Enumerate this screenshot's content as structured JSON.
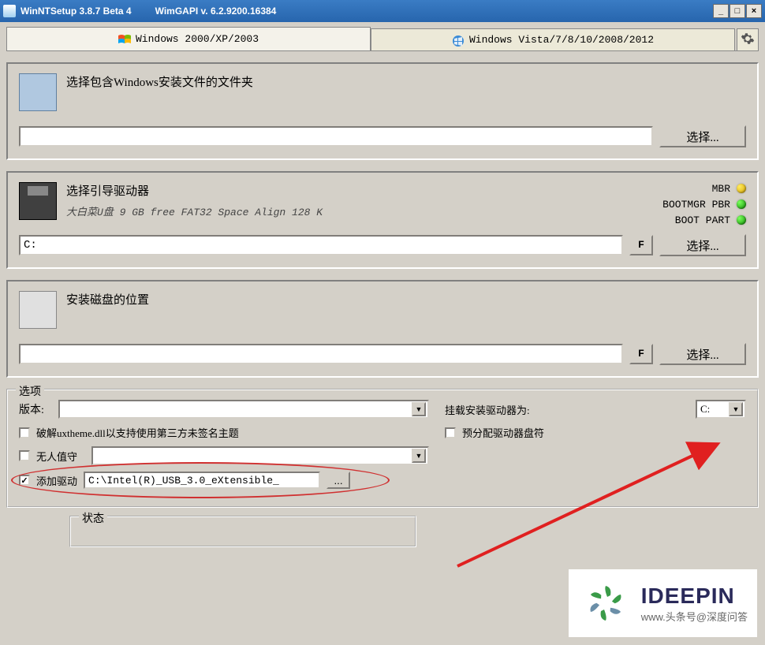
{
  "window": {
    "title": "WinNTSetup 3.8.7 Beta 4",
    "api": "WimGAPI v. 6.2.9200.16384"
  },
  "tabs": {
    "tab1": "Windows 2000/XP/2003",
    "tab2": "Windows Vista/7/8/10/2008/2012"
  },
  "panel1": {
    "title": "选择包含Windows安装文件的文件夹",
    "value": "",
    "select": "选择..."
  },
  "panel2": {
    "title": "选择引导驱动器",
    "sub": "大白菜U盘 9 GB free FAT32 Space Align 128 K",
    "value": "C:",
    "f": "F",
    "select": "选择...",
    "lights": {
      "mbr": "MBR",
      "pbr": "BOOTMGR PBR",
      "part": "BOOT PART"
    }
  },
  "panel3": {
    "title": "安装磁盘的位置",
    "value": "",
    "f": "F",
    "select": "选择..."
  },
  "options": {
    "legend": "选项",
    "version_label": "版本:",
    "version": "",
    "uxtheme": "破解uxtheme.dll以支持使用第三方未签名主题",
    "unattend": "无人值守",
    "adddriver": "添加驱动",
    "driver_path": "C:\\Intel(R)_USB_3.0_eXtensible_",
    "mount_label": "挂载安装驱动器为:",
    "mount_value": "C:",
    "prealloc": "预分配驱动器盘符"
  },
  "status": {
    "legend": "状态"
  },
  "watermark": {
    "brand": "IDEEPIN",
    "sub": "www.头条号@深度问答"
  }
}
